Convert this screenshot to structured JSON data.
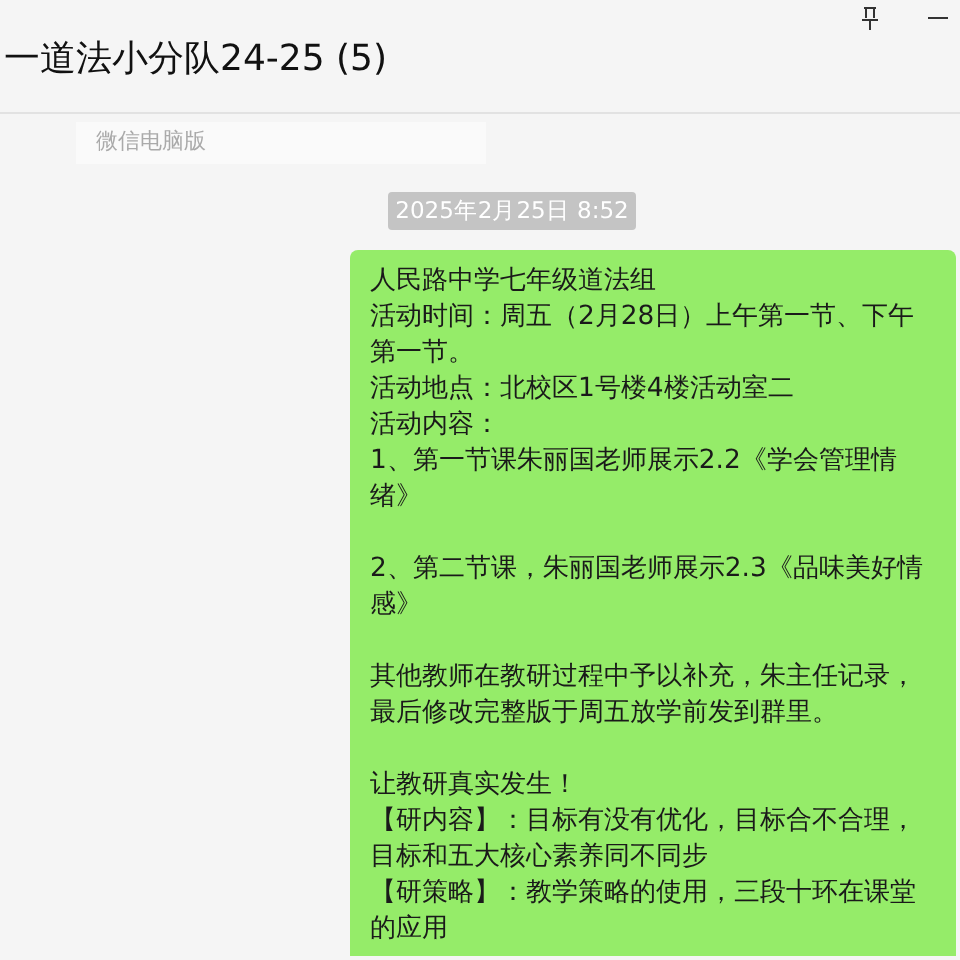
{
  "window": {
    "title": "一道法小分队24-25 (5)"
  },
  "quoted_message": {
    "text": "微信电脑版"
  },
  "timestamp": "2025年2月25日 8:52",
  "message": {
    "paragraphs": [
      [
        "人民路中学七年级道法组",
        "活动时间：周五（2月28日）上午第一节、下午",
        "第一节。",
        "活动地点：北校区1号楼4楼活动室二",
        "活动内容：",
        "1、第一节课朱丽国老师展示2.2《学会管理情",
        "绪》"
      ],
      [
        "2、第二节课，朱丽国老师展示2.3《品味美好情",
        "感》"
      ],
      [
        "其他教师在教研过程中予以补充，朱主任记录，",
        "最后修改完整版于周五放学前发到群里。"
      ],
      [
        "让教研真实发生！",
        "【研内容】：目标有没有优化，目标合不合理，",
        "目标和五大核心素养同不同步",
        "【研策略】：教学策略的使用，三段十环在课堂",
        "的应用"
      ]
    ]
  }
}
